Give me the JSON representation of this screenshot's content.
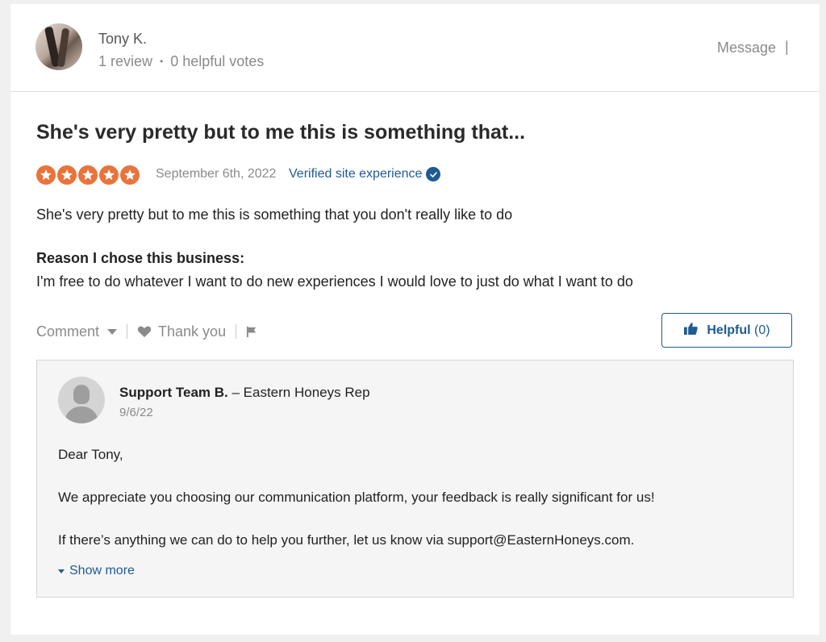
{
  "reviewer": {
    "name": "Tony K.",
    "reviews": "1 review",
    "dot": "•",
    "helpful_votes": "0 helpful votes",
    "message_label": "Message",
    "separator": "|"
  },
  "review": {
    "title": "She's very pretty but to me this is something that...",
    "rating": 5,
    "star_color": "#e8743b",
    "date": "September 6th, 2022",
    "verified_label": "Verified site experience",
    "text": "She's very pretty but to me this is something that you don't really like to do",
    "reason_heading": "Reason I chose this business:",
    "reason_text": "I'm free to do whatever I want to do new experiences I would love to just do what I want to do"
  },
  "actions": {
    "comment_label": "Comment",
    "thank_you_label": "Thank you",
    "helpful_label": "Helpful",
    "helpful_count": "(0)"
  },
  "reply": {
    "author": "Support Team B.",
    "role": "– Eastern Honeys Rep",
    "date": "9/6/22",
    "paragraphs": [
      "Dear Tony,",
      "We appreciate you choosing our communication platform, your feedback is really significant for us!",
      "If there’s anything we can do to help you further, let us know via support@EasternHoneys.com."
    ],
    "show_more_label": "Show more"
  },
  "colors": {
    "link_blue": "#1f5b94",
    "muted_gray": "#8a8a8a"
  }
}
